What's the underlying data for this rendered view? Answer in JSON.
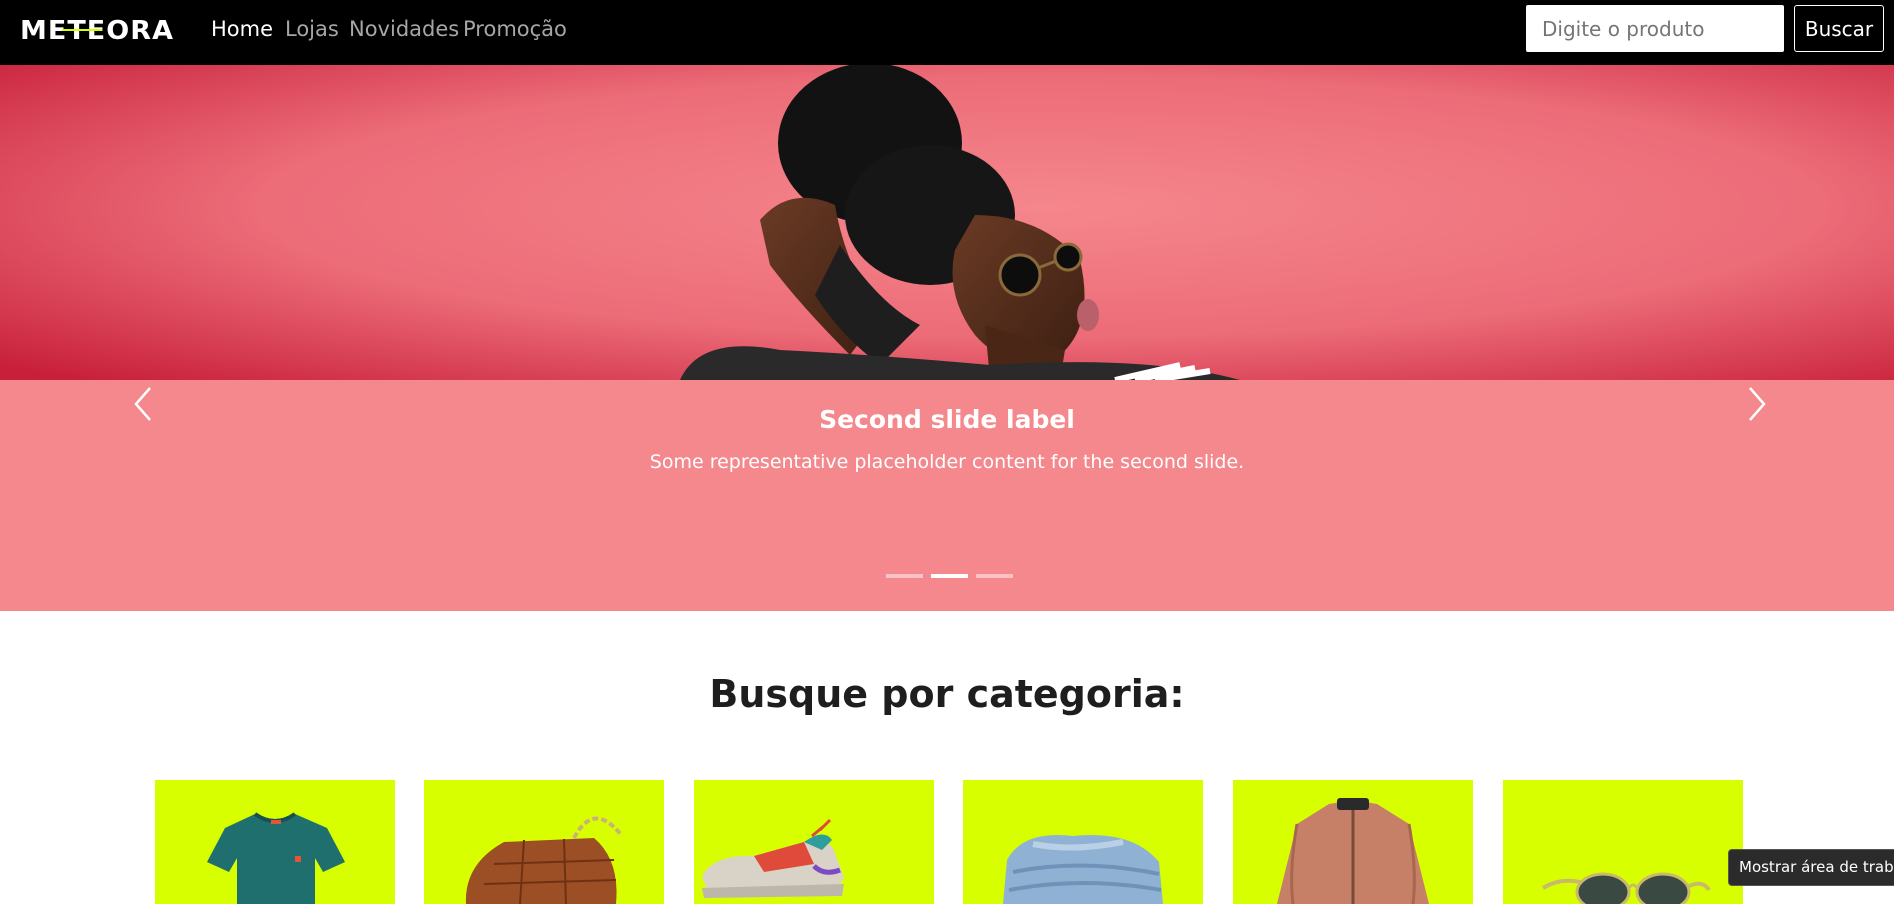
{
  "brand": {
    "logo_text": "METEORA"
  },
  "nav": {
    "links": [
      {
        "label": "Home",
        "active": true
      },
      {
        "label": "Lojas",
        "active": false
      },
      {
        "label": "Novidades",
        "active": false
      },
      {
        "label": "Promoção",
        "active": false
      }
    ]
  },
  "search": {
    "placeholder": "Digite o produto",
    "value": "",
    "button_label": "Buscar"
  },
  "carousel": {
    "active_slide": 2,
    "slide_count": 3,
    "caption_title": "Second slide label",
    "caption_text": "Some representative placeholder content for the second slide.",
    "prev_icon": "chevron-left-icon",
    "next_icon": "chevron-right-icon"
  },
  "categories": {
    "title": "Busque por categoria:",
    "items": [
      {
        "icon": "tshirt-icon"
      },
      {
        "icon": "handbag-icon"
      },
      {
        "icon": "sneaker-icon"
      },
      {
        "icon": "jeans-icon"
      },
      {
        "icon": "jacket-icon"
      },
      {
        "icon": "sunglasses-icon"
      }
    ]
  },
  "tooltip": {
    "text": "Mostrar área de trabalho"
  },
  "colors": {
    "navbar_bg": "#000000",
    "hero_pink": "#f4888c",
    "category_bg": "#d8ff00",
    "logo_accent": "#d8ff00"
  }
}
